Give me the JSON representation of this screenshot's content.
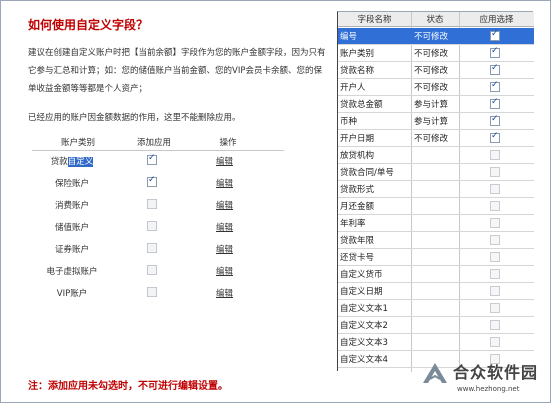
{
  "help": {
    "title": "如何使用自定义字段？",
    "para1": "建议在创建自定义账户时把【当前余额】字段作为您的账户金额字段，因为只有它参与汇总和计算；如：您的储值账户当前金额、您的VIP会员卡余额、您的保单收益金额等等都是个人资产；",
    "para2": "已经应用的账户因金额数据的作用，这里不能删除应用。",
    "columns": {
      "type": "账户类别",
      "add": "添加应用",
      "op": "操作"
    },
    "accounts": [
      {
        "name_prefix": "贷款",
        "name_highlight": "自定义",
        "checked": true,
        "edit": "编辑"
      },
      {
        "name_prefix": "保险账户",
        "name_highlight": "",
        "checked": true,
        "edit": "编辑"
      },
      {
        "name_prefix": "消费账户",
        "name_highlight": "",
        "checked": false,
        "edit": "编辑"
      },
      {
        "name_prefix": "储值账户",
        "name_highlight": "",
        "checked": false,
        "edit": "编辑"
      },
      {
        "name_prefix": "证券账户",
        "name_highlight": "",
        "checked": false,
        "edit": "编辑"
      },
      {
        "name_prefix": "电子虚拟账户",
        "name_highlight": "",
        "checked": false,
        "edit": "编辑"
      },
      {
        "name_prefix": "VIP账户",
        "name_highlight": "",
        "checked": false,
        "edit": "编辑"
      }
    ],
    "note": "注：添加应用未勾选时，不可进行编辑设置。"
  },
  "grid": {
    "headers": {
      "field": "字段名称",
      "status": "状态",
      "apply": "应用选择"
    },
    "rows": [
      {
        "field": "编号",
        "status": "不可修改",
        "checked": true,
        "selected": true
      },
      {
        "field": "账户类别",
        "status": "不可修改",
        "checked": true
      },
      {
        "field": "贷款名称",
        "status": "不可修改",
        "checked": true
      },
      {
        "field": "开户人",
        "status": "不可修改",
        "checked": true
      },
      {
        "field": "贷款总金额",
        "status": "参与计算",
        "checked": true
      },
      {
        "field": "币种",
        "status": "参与计算",
        "checked": true
      },
      {
        "field": "开户日期",
        "status": "不可修改",
        "checked": true
      },
      {
        "field": "放贷机构",
        "status": "",
        "checked": false
      },
      {
        "field": "贷款合同/单号",
        "status": "",
        "checked": false
      },
      {
        "field": "贷款形式",
        "status": "",
        "checked": false
      },
      {
        "field": "月还金额",
        "status": "",
        "checked": false
      },
      {
        "field": "年利率",
        "status": "",
        "checked": false
      },
      {
        "field": "贷款年限",
        "status": "",
        "checked": false
      },
      {
        "field": "还贷卡号",
        "status": "",
        "checked": false
      },
      {
        "field": "自定义货币",
        "status": "",
        "checked": false
      },
      {
        "field": "自定义日期",
        "status": "",
        "checked": false
      },
      {
        "field": "自定义文本1",
        "status": "",
        "checked": false
      },
      {
        "field": "自定义文本2",
        "status": "",
        "checked": false
      },
      {
        "field": "自定义文本3",
        "status": "",
        "checked": false
      },
      {
        "field": "自定义文本4",
        "status": "",
        "checked": false
      }
    ]
  },
  "watermark": {
    "text": "合众软件园",
    "url": "www.hezhong.net"
  },
  "colors": {
    "accent": "#2f6fd6",
    "note": "#c00000"
  }
}
